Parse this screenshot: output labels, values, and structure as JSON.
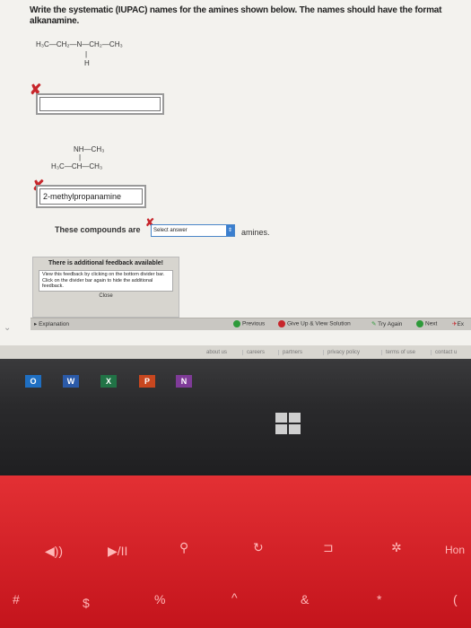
{
  "question": {
    "text": "Write the systematic (IUPAC) names for the amines shown below. The names should have the format alkanamine."
  },
  "compound1": {
    "structure_main": "H₃C—CH₂—N—CH₂—CH₃",
    "structure_sub": "H",
    "answer_value": ""
  },
  "compound2": {
    "structure_top": "NH—CH₃",
    "structure_main": "H₃C—CH—CH₃",
    "answer_value": "2-methylpropanamine"
  },
  "classification": {
    "prefix": "These compounds are",
    "select_value": "Select answer",
    "suffix": "amines."
  },
  "feedback": {
    "title": "There is additional feedback available!",
    "body": "View this feedback by clicking on the bottom divider bar. Click on the divider bar again to hide the additional feedback.",
    "close_label": "Close"
  },
  "toolbar": {
    "explanation": "Explanation",
    "previous": "Previous",
    "give_up": "Give Up & View Solution",
    "try_again": "Try Again",
    "next": "Next",
    "exit": "Ex"
  },
  "footer_links": [
    "about us",
    "careers",
    "partners",
    "privacy policy",
    "terms of use",
    "contact u"
  ],
  "taskbar": {
    "outlook": "O",
    "word": "W",
    "excel": "X",
    "powerpoint": "P",
    "onenote": "N"
  },
  "keyboard_keys": {
    "home": "Hon",
    "hash": "#",
    "dollar": "$",
    "percent": "%",
    "caret": "^",
    "amp": "&",
    "star": "*",
    "paren": "("
  },
  "colors": {
    "error": "#c7262b",
    "select_accent": "#3b7fcf",
    "keyboard": "#d8232a"
  }
}
